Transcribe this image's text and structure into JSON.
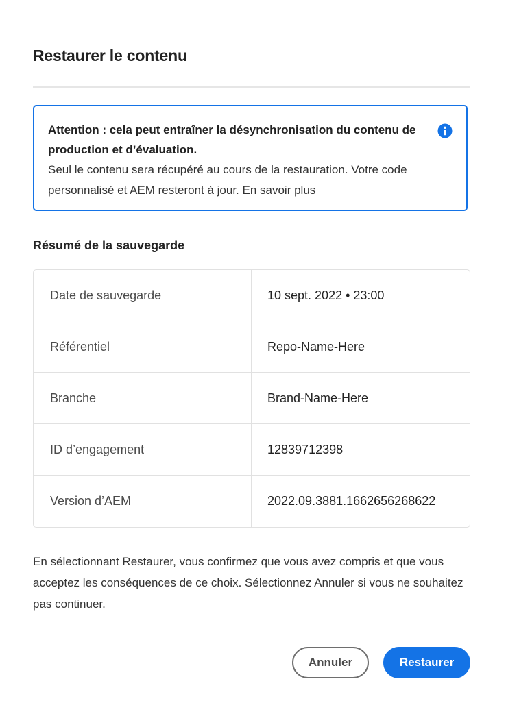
{
  "dialog": {
    "title": "Restaurer le contenu"
  },
  "notice": {
    "heading": "Attention : cela peut entraîner la désynchronisation du contenu de production et d’évaluation.",
    "body": "Seul le contenu sera récupéré au cours de la restauration. Votre code personnalisé et AEM resteront à jour. ",
    "link_label": "En savoir plus",
    "icon": "info-icon",
    "accent_color": "#1473e6"
  },
  "summary": {
    "heading": "Résumé de la sauvegarde",
    "rows": [
      {
        "label": "Date de sauvegarde",
        "value": "10 sept. 2022 • 23:00"
      },
      {
        "label": "Référentiel",
        "value": "Repo-Name-Here"
      },
      {
        "label": "Branche",
        "value": "Brand-Name-Here"
      },
      {
        "label": "ID d’engagement",
        "value": "12839712398"
      },
      {
        "label": "Version d’AEM",
        "value": "2022.09.3881.1662656268622"
      }
    ]
  },
  "confirmation": {
    "text": "En sélectionnant Restaurer, vous confirmez que vous avez compris et que vous acceptez les conséquences de ce choix. Sélectionnez Annuler si vous ne souhaitez pas continuer."
  },
  "actions": {
    "cancel_label": "Annuler",
    "restore_label": "Restaurer",
    "primary_color": "#1473e6"
  }
}
